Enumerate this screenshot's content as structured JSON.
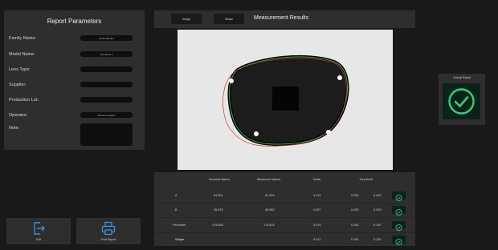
{
  "report": {
    "title": "Report Parameters",
    "fields": [
      {
        "label": "Family Name:",
        "value": "Smith-Weston"
      },
      {
        "label": "Model Name:",
        "value": "Larissame 1"
      },
      {
        "label": "Lens Type:",
        "value": ""
      },
      {
        "label": "Supplier:",
        "value": ""
      },
      {
        "label": "Production Lot:",
        "value": ""
      },
      {
        "label": "Operator:",
        "value": "Giovanni Schulz"
      },
      {
        "label": "Note:",
        "value": ""
      }
    ]
  },
  "buttons": {
    "exit": {
      "label": "Exit",
      "icon": "exit-icon"
    },
    "print": {
      "label": "Print Report",
      "icon": "printer-icon"
    }
  },
  "header": {
    "title": "Measurement Results",
    "btn1": "Sedge",
    "btn2": "Shape"
  },
  "table": {
    "columns": [
      "Nominal Values",
      "Measured Values",
      "Delta",
      "Threshold"
    ],
    "rows": [
      {
        "name": "A",
        "nominal": "61.501",
        "measured": "61.515",
        "delta": "0.014",
        "th_low": "0.030",
        "th_high": "0.030"
      },
      {
        "name": "B",
        "nominal": "45.575",
        "measured": "45.582",
        "delta": "0.007",
        "th_low": "0.030",
        "th_high": "0.030"
      },
      {
        "name": "Perimeter",
        "nominal": "179.836",
        "measured": "179.622",
        "delta": "0.076",
        "th_low": "0.100",
        "th_high": "0.100"
      },
      {
        "name": "Shape",
        "nominal": "",
        "measured": "",
        "delta": "0.012",
        "th_low": "0.100",
        "th_high": "0.100"
      }
    ]
  },
  "overall": {
    "title": "Overall Result",
    "icon": "check-circle-icon"
  },
  "colors": {
    "ok_green": "#2fd27a",
    "ok_bg": "#0a2219",
    "panel": "#2e2e2e",
    "background": "#191919",
    "contour_red": "#e03030",
    "contour_green": "#22b14c"
  }
}
